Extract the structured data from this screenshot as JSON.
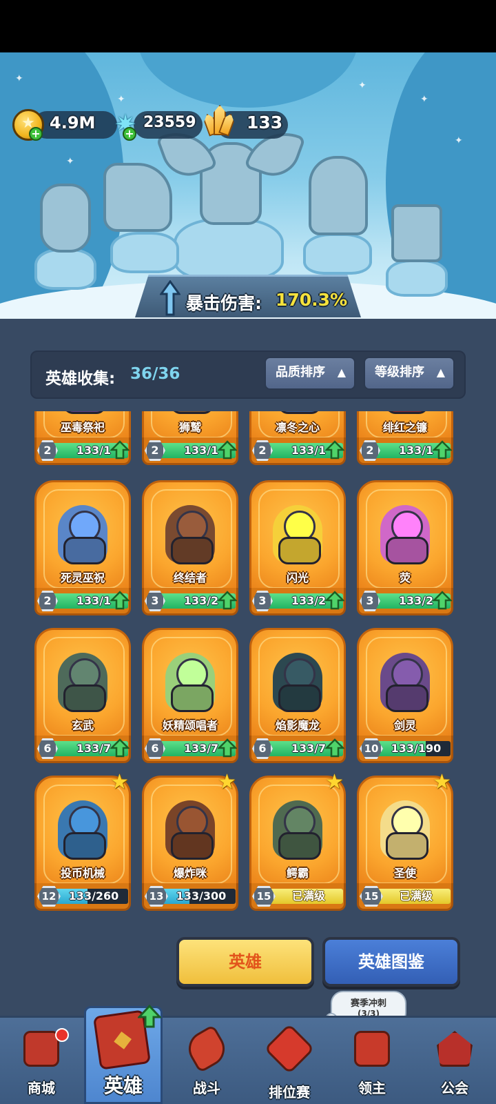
{
  "currency": {
    "gold": "4.9M",
    "gems": "23559",
    "crystals": "133"
  },
  "stat_banner": {
    "label": "暴击伤害:",
    "value": "170.3%"
  },
  "collection": {
    "label": "英雄收集:",
    "count": "36/36"
  },
  "sort": {
    "quality": "品质排序",
    "level": "等级排序"
  },
  "heroes": [
    {
      "name": "巫毒祭祀",
      "level": "2",
      "progress": "133/1",
      "fill": 1.0,
      "bar": "green",
      "upgradable": true,
      "color": "#7a4ea0"
    },
    {
      "name": "狮鹫",
      "level": "2",
      "progress": "133/1",
      "fill": 1.0,
      "bar": "green",
      "upgradable": true,
      "color": "#9b6a3a"
    },
    {
      "name": "凛冬之心",
      "level": "2",
      "progress": "133/1",
      "fill": 1.0,
      "bar": "green",
      "upgradable": true,
      "color": "#4a6fb0"
    },
    {
      "name": "绯红之镰",
      "level": "2",
      "progress": "133/1",
      "fill": 1.0,
      "bar": "green",
      "upgradable": true,
      "color": "#b0303a"
    },
    {
      "name": "死灵巫祝",
      "level": "2",
      "progress": "133/1",
      "fill": 1.0,
      "bar": "green",
      "upgradable": true,
      "color": "#5a86c8"
    },
    {
      "name": "终结者",
      "level": "3",
      "progress": "133/2",
      "fill": 1.0,
      "bar": "green",
      "upgradable": true,
      "color": "#7a4a30"
    },
    {
      "name": "闪光",
      "level": "3",
      "progress": "133/2",
      "fill": 1.0,
      "bar": "green",
      "upgradable": true,
      "color": "#f5d03a"
    },
    {
      "name": "荧",
      "level": "3",
      "progress": "133/2",
      "fill": 1.0,
      "bar": "green",
      "upgradable": true,
      "color": "#d068c8"
    },
    {
      "name": "玄武",
      "level": "6",
      "progress": "133/7",
      "fill": 1.0,
      "bar": "green",
      "upgradable": true,
      "color": "#4e6a5a"
    },
    {
      "name": "妖精颂唱者",
      "level": "6",
      "progress": "133/7",
      "fill": 1.0,
      "bar": "green",
      "upgradable": true,
      "color": "#9ad07a"
    },
    {
      "name": "焰影魔龙",
      "level": "6",
      "progress": "133/7",
      "fill": 1.0,
      "bar": "green",
      "upgradable": true,
      "color": "#2c4850"
    },
    {
      "name": "剑灵",
      "level": "10",
      "progress": "133/190",
      "fill": 0.7,
      "bar": "green",
      "upgradable": false,
      "color": "#6a4a8a"
    },
    {
      "name": "投币机械",
      "level": "12",
      "progress": "133/260",
      "fill": 0.51,
      "bar": "blue",
      "upgradable": false,
      "star": true,
      "color": "#3a78b0"
    },
    {
      "name": "爆炸咪",
      "level": "13",
      "progress": "133/300",
      "fill": 0.44,
      "bar": "blue",
      "upgradable": false,
      "star": true,
      "color": "#7a4428"
    },
    {
      "name": "鳄霸",
      "level": "15",
      "progress": "已满级",
      "fill": 1.0,
      "bar": "max",
      "upgradable": false,
      "star": true,
      "color": "#4f6a50"
    },
    {
      "name": "圣使",
      "level": "15",
      "progress": "已满级",
      "fill": 1.0,
      "bar": "max",
      "upgradable": false,
      "star": true,
      "color": "#f4dc8a"
    }
  ],
  "actions": {
    "heroes": "英雄",
    "codex": "英雄图鉴"
  },
  "season": {
    "line1": "赛季冲刺",
    "line2": "(3/3)"
  },
  "nav": {
    "shop": "商城",
    "heroes": "英雄",
    "battle": "战斗",
    "ranked": "排位赛",
    "lord": "领主",
    "guild": "公会"
  }
}
